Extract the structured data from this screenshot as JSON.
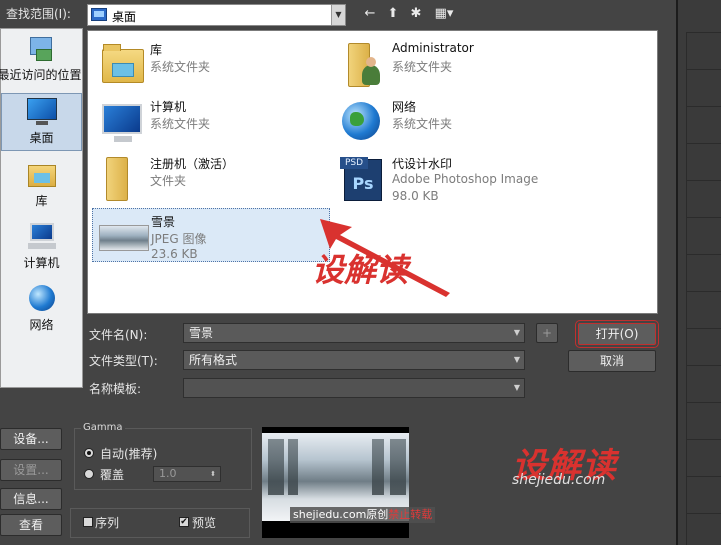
{
  "lookin": {
    "label": "查找范围(I):",
    "value": "桌面"
  },
  "toolbar": {
    "back": "←",
    "up": "⬆",
    "newfolder": "✱",
    "view": "▦▾"
  },
  "places": [
    {
      "label": "最近访问的位置"
    },
    {
      "label": "桌面"
    },
    {
      "label": "库"
    },
    {
      "label": "计算机"
    },
    {
      "label": "网络"
    }
  ],
  "files": [
    {
      "name": "库",
      "type": "系统文件夹",
      "size": ""
    },
    {
      "name": "Administrator",
      "type": "系统文件夹",
      "size": ""
    },
    {
      "name": "计算机",
      "type": "系统文件夹",
      "size": ""
    },
    {
      "name": "网络",
      "type": "系统文件夹",
      "size": ""
    },
    {
      "name": "注册机（激活）",
      "type": "文件夹",
      "size": ""
    },
    {
      "name": "代设计水印",
      "type": "Adobe Photoshop Image",
      "size": "98.0 KB",
      "icon_text": "Ps",
      "icon_tag": "PSD"
    },
    {
      "name": "雪景",
      "type": "JPEG 图像",
      "size": "23.6 KB"
    }
  ],
  "form": {
    "filename_label": "文件名(N):",
    "filename_value": "雪景",
    "filetype_label": "文件类型(T):",
    "filetype_value": "所有格式",
    "template_label": "名称模板:",
    "template_value": "",
    "plus_label": "+",
    "open_label": "打开(O)",
    "cancel_label": "取消"
  },
  "left_buttons": {
    "setup": "设备...",
    "settings": "设置...",
    "info": "信息...",
    "view": "查看"
  },
  "gamma": {
    "title": "Gamma",
    "auto_label": "自动(推荐)",
    "override_label": "覆盖",
    "override_value": "1.0"
  },
  "options": {
    "sequence_label": "序列",
    "preview_label": "预览",
    "sequence_checked": false,
    "preview_checked": true
  },
  "watermark": {
    "site": "shejiedu.com原创",
    "ban": "禁止转载"
  },
  "brand": {
    "name": "设解读",
    "url": "shejiedu.com",
    "overlay": "设解读"
  },
  "colors": {
    "accent_red": "#d9322f",
    "selection": "#dbe9f7"
  }
}
